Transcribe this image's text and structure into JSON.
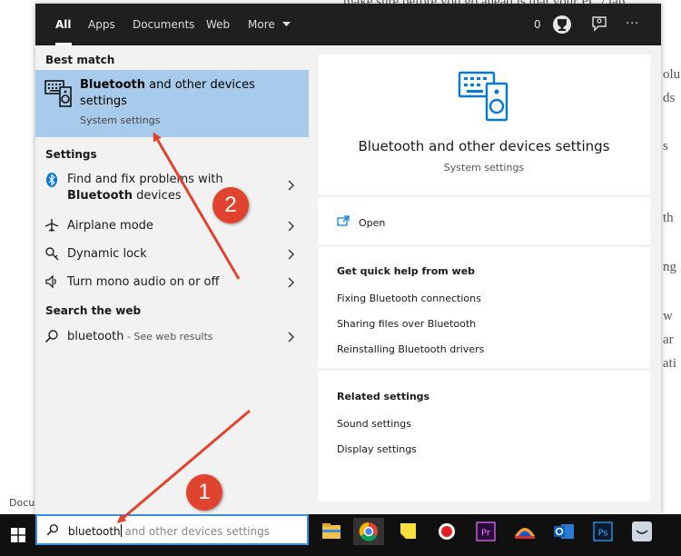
{
  "background_doc": {
    "lines": [
      "make sure before you go ahead is that your PC / lap",
      "olu",
      "ds",
      "s",
      "th",
      "ng",
      "w",
      "ar",
      "ati"
    ],
    "status": "Docu"
  },
  "topbar": {
    "tabs": [
      "All",
      "Apps",
      "Documents",
      "Web",
      "More"
    ],
    "count": "0",
    "more_label": "···"
  },
  "left": {
    "best_match_title": "Best match",
    "best": {
      "title_bold": "Bluetooth",
      "title_rest": " and other devices settings",
      "subtitle": "System settings"
    },
    "settings_title": "Settings",
    "settings": [
      {
        "pre": "Find and fix problems with ",
        "bold": "Bluetooth",
        "post": " devices",
        "icon": "bluetooth-icon"
      },
      {
        "pre": "Airplane mode",
        "bold": "",
        "post": "",
        "icon": "airplane-icon"
      },
      {
        "pre": "Dynamic lock",
        "bold": "",
        "post": "",
        "icon": "key-icon"
      },
      {
        "pre": "Turn mono audio on or off",
        "bold": "",
        "post": "",
        "icon": "speaker-icon"
      }
    ],
    "web_title": "Search the web",
    "web": {
      "query": "bluetooth",
      "suffix": " - See web results"
    }
  },
  "right": {
    "title": "Bluetooth and other devices settings",
    "subtitle": "System settings",
    "open_label": "Open",
    "help_title": "Get quick help from web",
    "help_links": [
      "Fixing Bluetooth connections",
      "Sharing files over Bluetooth",
      "Reinstalling Bluetooth drivers"
    ],
    "related_title": "Related settings",
    "related_links": [
      "Sound settings",
      "Display settings"
    ]
  },
  "taskbar": {
    "search_typed": "bluetooth",
    "search_hint": " and other devices settings",
    "apps": [
      "file-explorer-icon",
      "chrome-icon",
      "sticky-notes-icon",
      "record-icon",
      "premiere-icon",
      "vpn-icon",
      "outlook-icon",
      "photoshop-icon",
      "finder-icon"
    ]
  },
  "annotations": {
    "badge1": "1",
    "badge2": "2"
  },
  "colors": {
    "accent": "#0078d7",
    "selected": "#a8cbeb",
    "annotation": "#e0442f"
  }
}
